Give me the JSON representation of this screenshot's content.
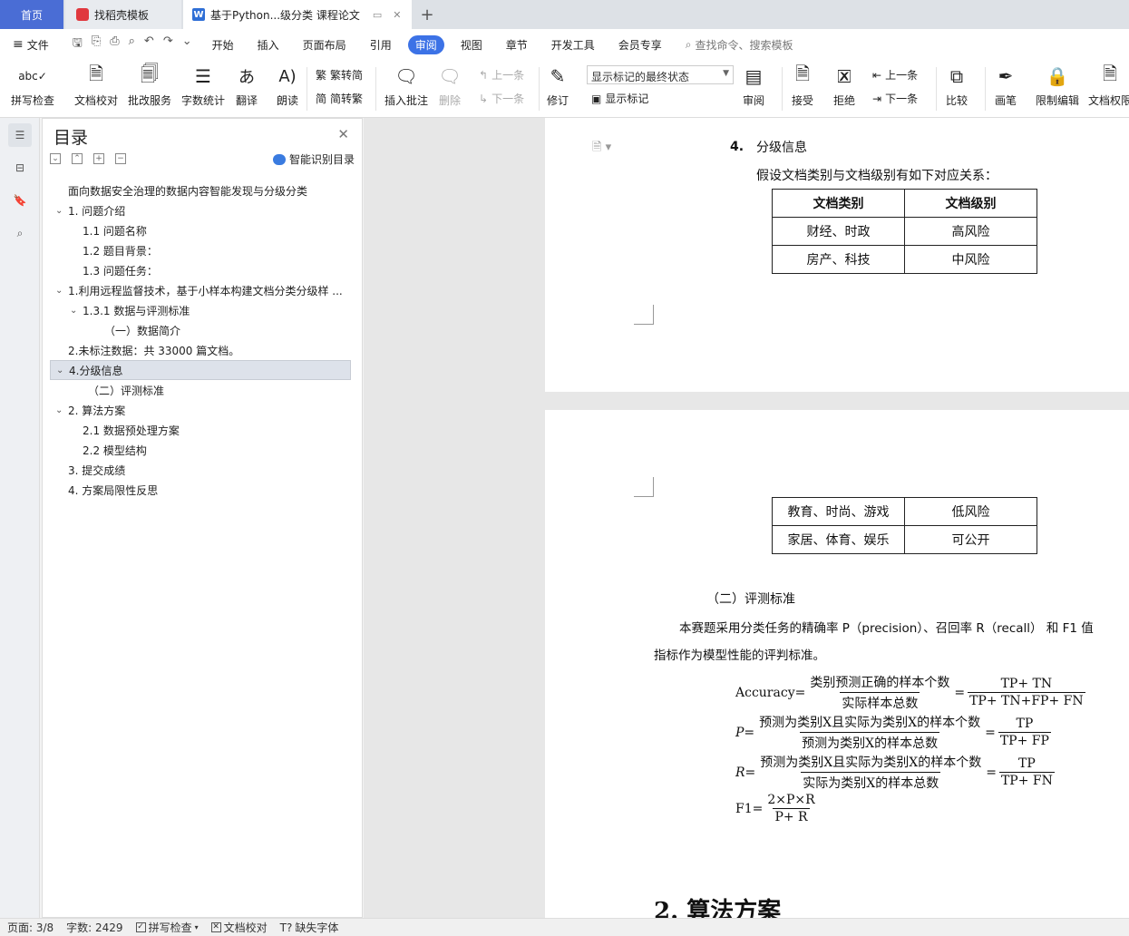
{
  "tabs": {
    "home": "首页",
    "template": "找稻壳模板",
    "doc": "基于Python...级分类 课程论文",
    "add": "+"
  },
  "menu": {
    "file": "文件",
    "items": [
      "开始",
      "插入",
      "页面布局",
      "引用",
      "审阅",
      "视图",
      "章节",
      "开发工具",
      "会员专享"
    ],
    "active": "审阅",
    "search": "查找命令、搜索模板"
  },
  "ribbon": {
    "spellcheck": "拼写检查",
    "doc_check": "文档校对",
    "review_service": "批改服务",
    "word_count": "字数统计",
    "translate": "翻译",
    "read_aloud": "朗读",
    "to_traditional": "繁转简",
    "to_simplified": "简转繁",
    "insert_comment": "插入批注",
    "delete": "删除",
    "prev_comment": "上一条",
    "next_comment": "下一条",
    "revise": "修订",
    "markup_select": "显示标记的最终状态",
    "show_markup": "显示标记",
    "review": "审阅",
    "accept": "接受",
    "reject": "拒绝",
    "prev_change": "上一条",
    "next_change": "下一条",
    "compare": "比较",
    "pen": "画笔",
    "restrict": "限制编辑",
    "doc_permission": "文档权限"
  },
  "toc": {
    "title": "目录",
    "smart": "智能识别目录",
    "items": [
      {
        "text": "面向数据安全治理的数据内容智能发现与分级分类",
        "level": 0,
        "chev": ""
      },
      {
        "text": "1. 问题介绍",
        "level": 0,
        "chev": "v"
      },
      {
        "text": "1.1  问题名称",
        "level": 1,
        "chev": ""
      },
      {
        "text": "1.2  题目背景：",
        "level": 1,
        "chev": ""
      },
      {
        "text": "1.3  问题任务：",
        "level": 1,
        "chev": ""
      },
      {
        "text": "1.利用远程监督技术，基于小样本构建文档分类分级样 ...",
        "level": 0,
        "chev": "v"
      },
      {
        "text": "1.3.1  数据与评测标准",
        "level": 1,
        "chev": "v"
      },
      {
        "text": "（一）数据简介",
        "level": 2,
        "chev": ""
      },
      {
        "text": "2.未标注数据：共 33000 篇文档。",
        "level": 0,
        "chev": ""
      },
      {
        "text": "4.分级信息",
        "level": 0,
        "chev": "v",
        "selected": true
      },
      {
        "text": "（二）评测标准",
        "level": 1.5,
        "chev": ""
      },
      {
        "text": "2.  算法方案",
        "level": 0,
        "chev": "v"
      },
      {
        "text": "2.1  数据预处理方案",
        "level": 1,
        "chev": ""
      },
      {
        "text": "2.2  模型结构",
        "level": 1,
        "chev": ""
      },
      {
        "text": "3.  提交成绩",
        "level": 0,
        "chev": ""
      },
      {
        "text": "4.  方案局限性反思",
        "level": 0,
        "chev": ""
      }
    ]
  },
  "document": {
    "sec_num": "4.",
    "sec_title": "分级信息",
    "intro": "假设文档类别与文档级别有如下对应关系：",
    "table_header": [
      "文档类别",
      "文档级别"
    ],
    "table_rows_p1": [
      [
        "财经、时政",
        "高风险"
      ],
      [
        "房产、科技",
        "中风险"
      ]
    ],
    "table_rows_p2": [
      [
        "教育、时尚、游戏",
        "低风险"
      ],
      [
        "家居、体育、娱乐",
        "可公开"
      ]
    ],
    "eval_title": "（二）评测标准",
    "para1": "本赛题采用分类任务的精确率 P（precision）、召回率 R（recall） 和 F1 值",
    "para2": "指标作为模型性能的评判标准。",
    "formulas": {
      "acc_lhs": "Accuracy",
      "acc_num": "类别预测正确的样本个数",
      "acc_den": "实际样本总数",
      "acc_num2": "TP+ TN",
      "acc_den2": "TP+ TN+FP+ FN",
      "p_lhs": "P",
      "p_num": "预测为类别X且实际为类别X的样本个数",
      "p_den": "预测为类别X的样本总数",
      "p_num2": "TP",
      "p_den2": "TP+ FP",
      "r_lhs": "R",
      "r_num": "预测为类别X且实际为类别X的样本个数",
      "r_den": "实际为类别X的样本总数",
      "r_num2": "TP",
      "r_den2": "TP+ FN",
      "f1_lhs": "F1",
      "f1_num": "2×P×R",
      "f1_den": "P+ R"
    },
    "next_heading": "2.  算法方案"
  },
  "status": {
    "page": "页面: 3/8",
    "words": "字数: 2429",
    "spell": "拼写检查",
    "proof": "文档校对",
    "missing_font": "缺失字体"
  }
}
